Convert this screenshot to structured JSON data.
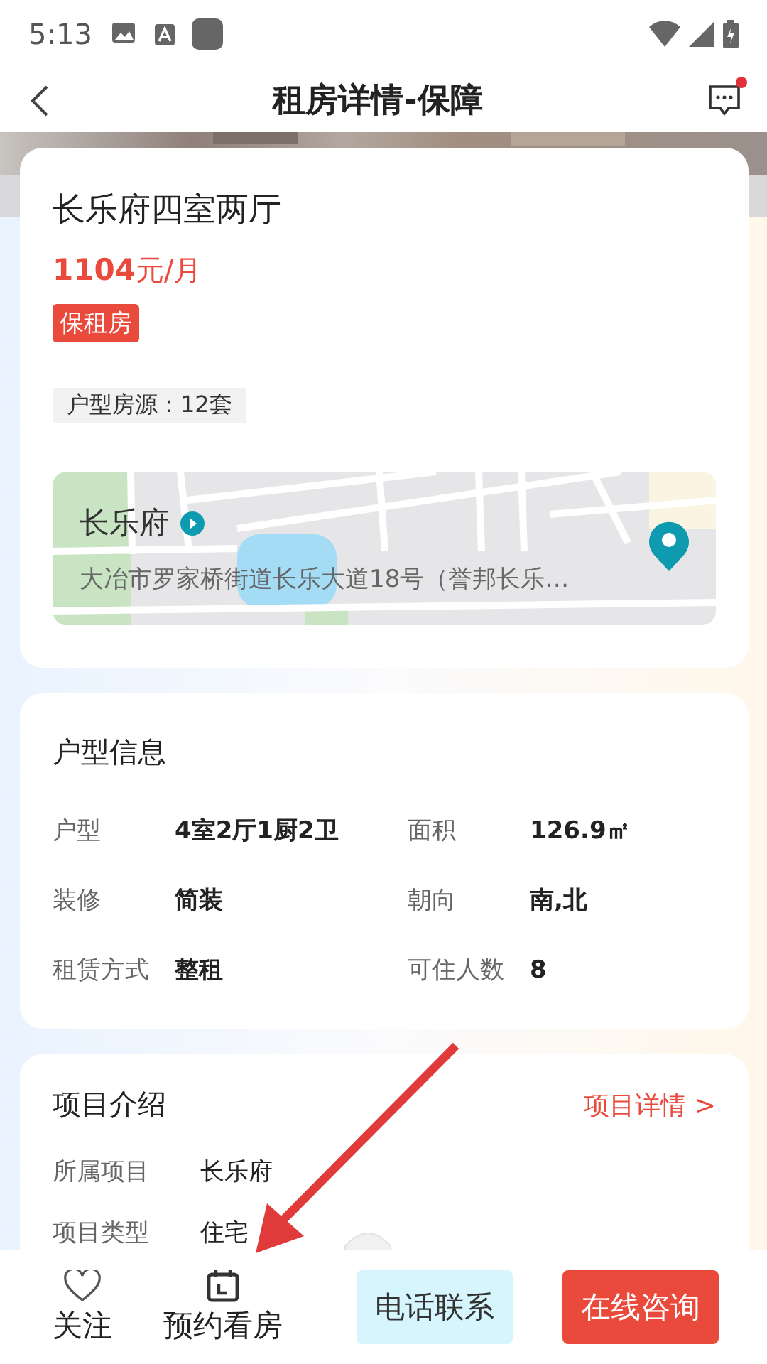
{
  "status_bar": {
    "time": "5:13"
  },
  "header": {
    "title": "租房详情-保障",
    "notification_dot": true
  },
  "listing": {
    "title": "长乐府四室两厅",
    "price": "1104",
    "price_unit": "元/月",
    "tag": "保租房",
    "units": "户型房源：12套",
    "map": {
      "name": "长乐府",
      "address": "大冶市罗家桥街道长乐大道18号（誉邦长乐…"
    }
  },
  "layout_info": {
    "title": "户型信息",
    "fields": [
      {
        "label": "户型",
        "value": "4室2厅1厨2卫"
      },
      {
        "label": "面积",
        "value": "126.9㎡"
      },
      {
        "label": "装修",
        "value": "简装"
      },
      {
        "label": "朝向",
        "value": "南,北"
      },
      {
        "label": "租赁方式",
        "value": "整租"
      },
      {
        "label": "可住人数",
        "value": "8"
      }
    ]
  },
  "project": {
    "title": "项目介绍",
    "link": "项目详情 >",
    "fields": [
      {
        "label": "所属项目",
        "value": "长乐府"
      },
      {
        "label": "项目类型",
        "value": "住宅"
      }
    ]
  },
  "bottom_bar": {
    "actions": [
      {
        "label": "关注",
        "kind": "heart"
      },
      {
        "label": "预约看房",
        "kind": "calendar"
      }
    ],
    "buttons": [
      {
        "label": "电话联系",
        "kind": "secondary"
      },
      {
        "label": "在线咨询",
        "kind": "primary"
      }
    ]
  }
}
